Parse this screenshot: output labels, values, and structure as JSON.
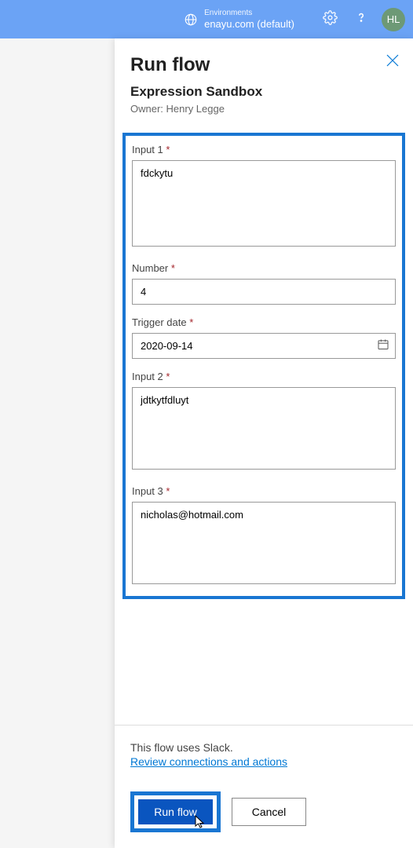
{
  "header": {
    "env_label": "Environments",
    "env_name": "enayu.com (default)",
    "avatar_initials": "HL"
  },
  "panel": {
    "title": "Run flow",
    "subtitle": "Expression Sandbox",
    "owner_prefix": "Owner: ",
    "owner_name": "Henry Legge"
  },
  "fields": {
    "input1": {
      "label": "Input 1",
      "value": "fdckytu"
    },
    "number": {
      "label": "Number",
      "value": "4"
    },
    "trigger_date": {
      "label": "Trigger date",
      "value": "2020-09-14"
    },
    "input2": {
      "label": "Input 2",
      "value": "jdtkytfdluyt"
    },
    "input3": {
      "label": "Input 3",
      "value": "nicholas@hotmail.com"
    }
  },
  "footer": {
    "uses_text": "This flow uses Slack.",
    "review_link": "Review connections and actions",
    "run_label": "Run flow",
    "cancel_label": "Cancel"
  }
}
